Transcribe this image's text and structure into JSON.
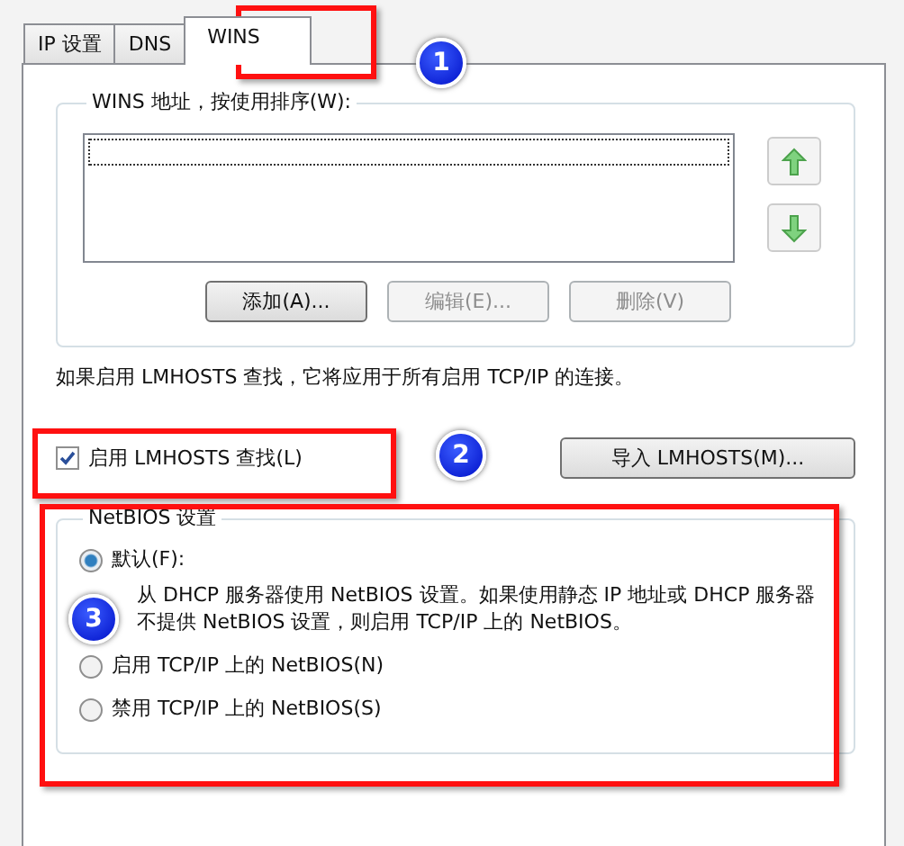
{
  "tabs": [
    {
      "label": "IP 设置",
      "selected": false
    },
    {
      "label": "DNS",
      "selected": false
    },
    {
      "label": "WINS",
      "selected": true
    }
  ],
  "wins_group": {
    "title": "WINS 地址，按使用排序(W):",
    "buttons": [
      {
        "label": "添加(A)...",
        "disabled": false
      },
      {
        "label": "编辑(E)...",
        "disabled": true
      },
      {
        "label": "删除(V)",
        "disabled": true
      }
    ]
  },
  "info_text": "如果启用 LMHOSTS 查找，它将应用于所有启用 TCP/IP 的连接。",
  "lmhosts": {
    "label": "启用 LMHOSTS 查找(L)",
    "checked": true
  },
  "import_button": "导入 LMHOSTS(M)...",
  "netbios_group": {
    "title": "NetBIOS 设置",
    "options": [
      {
        "label": "默认(F):",
        "selected": true,
        "description": "从 DHCP 服务器使用 NetBIOS 设置。如果使用静态 IP 地址或 DHCP 服务器不提供 NetBIOS 设置，则启用 TCP/IP 上的 NetBIOS。"
      },
      {
        "label": "启用 TCP/IP 上的 NetBIOS(N)",
        "selected": false
      },
      {
        "label": "禁用 TCP/IP 上的 NetBIOS(S)",
        "selected": false
      }
    ]
  },
  "annotations": [
    {
      "number": "1"
    },
    {
      "number": "2"
    },
    {
      "number": "3"
    }
  ]
}
